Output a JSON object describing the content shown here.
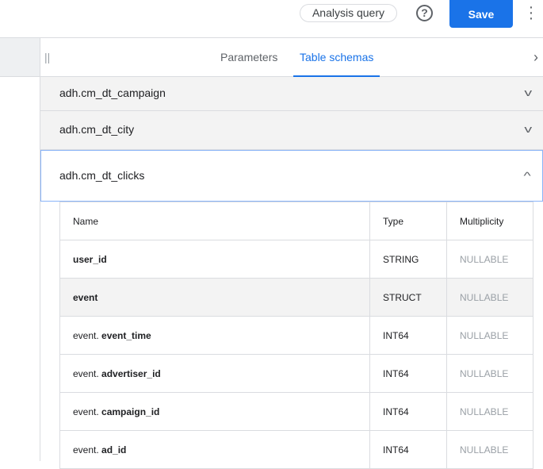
{
  "header": {
    "query_type": "Analysis query",
    "save_label": "Save"
  },
  "tabs": [
    {
      "label": "Parameters"
    },
    {
      "label": "Table schemas"
    }
  ],
  "tables": [
    {
      "name": "adh.cm_dt_campaign"
    },
    {
      "name": "adh.cm_dt_city"
    },
    {
      "name": "adh.cm_dt_clicks"
    }
  ],
  "schema": {
    "headers": [
      "Name",
      "Type",
      "Multiplicity"
    ],
    "rows": [
      {
        "prefix": "",
        "field": "user_id",
        "type": "STRING",
        "mult": "NULLABLE"
      },
      {
        "prefix": "",
        "field": "event",
        "type": "STRUCT",
        "mult": "NULLABLE"
      },
      {
        "prefix": "event. ",
        "field": "event_time",
        "type": "INT64",
        "mult": "NULLABLE"
      },
      {
        "prefix": "event. ",
        "field": "advertiser_id",
        "type": "INT64",
        "mult": "NULLABLE"
      },
      {
        "prefix": "event. ",
        "field": "campaign_id",
        "type": "INT64",
        "mult": "NULLABLE"
      },
      {
        "prefix": "event. ",
        "field": "ad_id",
        "type": "INT64",
        "mult": "NULLABLE"
      }
    ]
  }
}
